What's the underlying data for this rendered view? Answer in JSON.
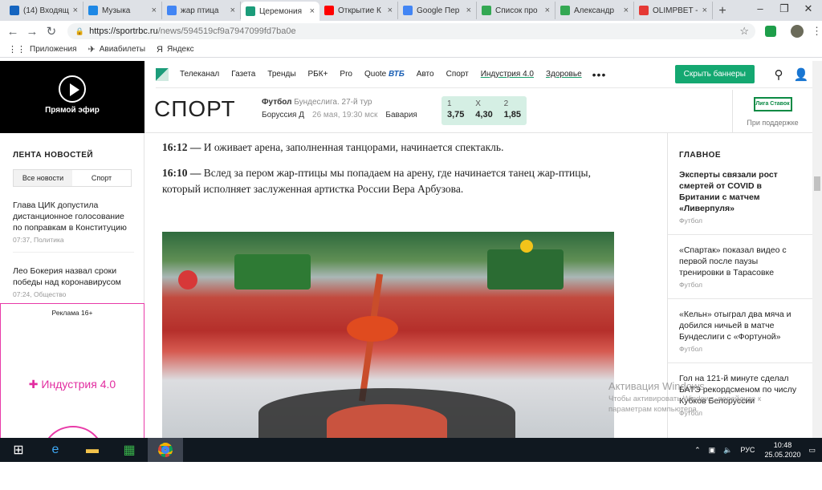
{
  "browser": {
    "tabs": [
      {
        "title": "(14) Входящ",
        "icon": "mail-icon",
        "color": "#1565c0"
      },
      {
        "title": "Музыка",
        "icon": "music-play-icon",
        "color": "#1e88e5"
      },
      {
        "title": "жар птица",
        "icon": "google-icon",
        "color": "#4285f4"
      },
      {
        "title": "Церемония",
        "icon": "rbc-icon",
        "color": "#1b9c7a"
      },
      {
        "title": "Открытие К",
        "icon": "youtube-icon",
        "color": "#ff0000"
      },
      {
        "title": "Google Пер",
        "icon": "translate-icon",
        "color": "#4285f4"
      },
      {
        "title": "Список про",
        "icon": "sheet-icon",
        "color": "#34a853"
      },
      {
        "title": "Александр",
        "icon": "sheet-icon",
        "color": "#34a853"
      },
      {
        "title": "OLIMPBET -",
        "icon": "olimpbet-icon",
        "color": "#e53935"
      }
    ],
    "url_host": "https://sportrbc.ru",
    "url_path": "/news/594519cf9a7947099fd7ba0e",
    "bookmarks": [
      {
        "label": "Приложения",
        "icon": "apps-grid-icon"
      },
      {
        "label": "Авиабилеты",
        "icon": "plane-icon"
      },
      {
        "label": "Яндекс",
        "icon": "yandex-icon"
      }
    ]
  },
  "site": {
    "live_label": "Прямой эфир",
    "nav": [
      "Телеканал",
      "Газета",
      "Тренды",
      "РБК+",
      "Pro",
      "Quote",
      "Авто",
      "Спорт",
      "Индустрия 4.0",
      "Здоровье"
    ],
    "vtb": "ВТБ",
    "banner_button": "Скрыть баннеры",
    "section_title": "СПОРТ",
    "match": {
      "sport": "Футбол",
      "league": "Бундеслига. 27-й тур",
      "home": "Боруссия Д",
      "date": "26 мая, 19:30 мск",
      "away": "Бавария",
      "odds": [
        {
          "k": "1",
          "v": "3,75"
        },
        {
          "k": "X",
          "v": "4,30"
        },
        {
          "k": "2",
          "v": "1,85"
        }
      ]
    },
    "sponsor_logo": "Лига Ставок",
    "sponsor_caption": "При поддержке"
  },
  "feed": {
    "title": "ЛЕНТА НОВОСТЕЙ",
    "tab_all": "Все новости",
    "tab_sport": "Спорт",
    "items": [
      {
        "text": "Глава ЦИК допустила дистанционное голосование по поправкам в Конституцию",
        "meta": "07:37, Политика"
      },
      {
        "text": "Лео Бокерия назвал сроки победы над коронавирусом",
        "meta": "07:24, Общество"
      }
    ],
    "ad_label": "Реклама 16+",
    "ad_brand": "Индустрия 4.0"
  },
  "article": {
    "p1_time": "16:12 —",
    "p1_text": " И оживает арена, заполненная танцорами, начинается спектакль.",
    "p2_time": "16:10 —",
    "p2_text": " Вслед за пером жар-птицы мы попадаем на арену, где начинается танец жар-птицы, который исполняет заслуженная артистка России Вера Арбузова."
  },
  "main_news": {
    "title": "ГЛАВНОЕ",
    "items": [
      {
        "text": "Эксперты связали рост смертей от COVID в Британии с матчем «Ливерпуля»",
        "meta": "Футбол",
        "bold": true
      },
      {
        "text": "«Спартак» показал видео с первой после паузы тренировки в Тарасовке",
        "meta": "Футбол",
        "bold": false
      },
      {
        "text": "«Кельн» отыграл два мяча и добился ничьей в матче Бундеслиги с «Фортуной»",
        "meta": "Футбол",
        "bold": false
      },
      {
        "text": "Гол на 121-й минуте сделал БАТЭ рекордсменом по числу Кубков Белоруссии",
        "meta": "Футбол",
        "bold": false
      }
    ]
  },
  "windows": {
    "activation_title": "Активация Windows",
    "activation_text": "Чтобы активировать Windows, перейдите к параметрам компьютера.",
    "lang": "РУС",
    "time": "10:48",
    "date": "25.05.2020"
  }
}
